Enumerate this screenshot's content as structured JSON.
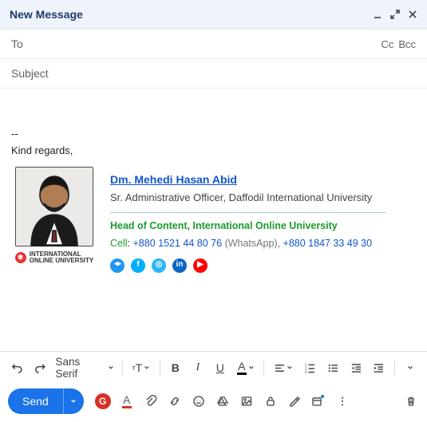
{
  "header": {
    "title": "New Message"
  },
  "fields": {
    "to_label": "To",
    "cc": "Cc",
    "bcc": "Bcc",
    "subject_placeholder": "Subject"
  },
  "body": {
    "separator": "--",
    "regards": "Kind regards,"
  },
  "signature": {
    "name": "Dm. Mehedi Hasan Abid",
    "title": "Sr. Administrative Officer, Daffodil International University",
    "role": "Head of Content, International Online University",
    "cell_label": "Cell",
    "phone1": "+880 1521 44 80 76",
    "whatsapp_suffix": "(WhatsApp),",
    "phone2": "+880 1847 33 49 30",
    "org_line1": "INTERNATIONAL",
    "org_line2": "ONLINE UNIVERSITY",
    "socials": {
      "scholar": "scholar-icon",
      "facebook": "f",
      "instagram": "◎",
      "linkedin": "in",
      "youtube": "▶"
    }
  },
  "toolbar": {
    "font": "Sans Serif",
    "size_glyph": "тT",
    "bold": "B",
    "italic": "I",
    "underline": "U",
    "textcolor": "A"
  },
  "actions": {
    "send": "Send",
    "grammarly": "G",
    "a_swatch": "A"
  }
}
